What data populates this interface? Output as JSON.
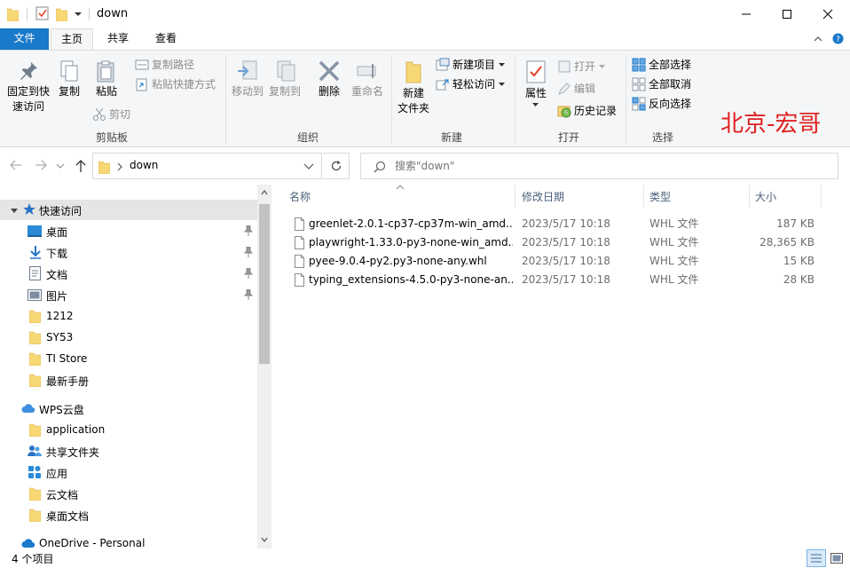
{
  "window": {
    "title": "down",
    "watermark": "北京-宏哥"
  },
  "ribbon_tabs": [
    "文件",
    "主页",
    "共享",
    "查看"
  ],
  "ribbon": {
    "clipboard": {
      "label": "剪贴板",
      "pin": [
        "固定到快",
        "速访问"
      ],
      "copy": "复制",
      "paste": "粘贴",
      "copy_path": "复制路径",
      "paste_shortcut": "粘贴快捷方式",
      "cut": "剪切"
    },
    "organize": {
      "label": "组织",
      "move_to": "移动到",
      "copy_to": "复制到",
      "delete": "删除",
      "rename": "重命名"
    },
    "new": {
      "label": "新建",
      "new_folder": [
        "新建",
        "文件夹"
      ],
      "new_item": "新建项目",
      "easy_access": "轻松访问"
    },
    "open": {
      "label": "打开",
      "properties": "属性",
      "open": "打开",
      "edit": "编辑",
      "history": "历史记录"
    },
    "select": {
      "label": "选择",
      "select_all": "全部选择",
      "select_none": "全部取消",
      "invert": "反向选择"
    }
  },
  "address": {
    "path": "down",
    "search_placeholder": "搜索\"down\""
  },
  "navpane": {
    "quick_access": "快速访问",
    "pinned": [
      "桌面",
      "下载",
      "文档",
      "图片"
    ],
    "folders": [
      "1212",
      "SY53",
      "TI Store",
      "最新手册"
    ],
    "wps": "WPS云盘",
    "wps_items": [
      "application",
      "共享文件夹",
      "应用",
      "云文档",
      "桌面文档"
    ],
    "onedrive": "OneDrive - Personal"
  },
  "columns": {
    "name": "名称",
    "date": "修改日期",
    "type": "类型",
    "size": "大小"
  },
  "files": [
    {
      "name": "greenlet-2.0.1-cp37-cp37m-win_amd...",
      "date": "2023/5/17 10:18",
      "type": "WHL 文件",
      "size": "187 KB"
    },
    {
      "name": "playwright-1.33.0-py3-none-win_amd...",
      "date": "2023/5/17 10:18",
      "type": "WHL 文件",
      "size": "28,365 KB"
    },
    {
      "name": "pyee-9.0.4-py2.py3-none-any.whl",
      "date": "2023/5/17 10:18",
      "type": "WHL 文件",
      "size": "15 KB"
    },
    {
      "name": "typing_extensions-4.5.0-py3-none-an...",
      "date": "2023/5/17 10:18",
      "type": "WHL 文件",
      "size": "28 KB"
    }
  ],
  "status": {
    "count": "4 个项目"
  },
  "colors": {
    "accent": "#1979ca",
    "folder": "#f8d775",
    "watermark": "#e02020"
  }
}
